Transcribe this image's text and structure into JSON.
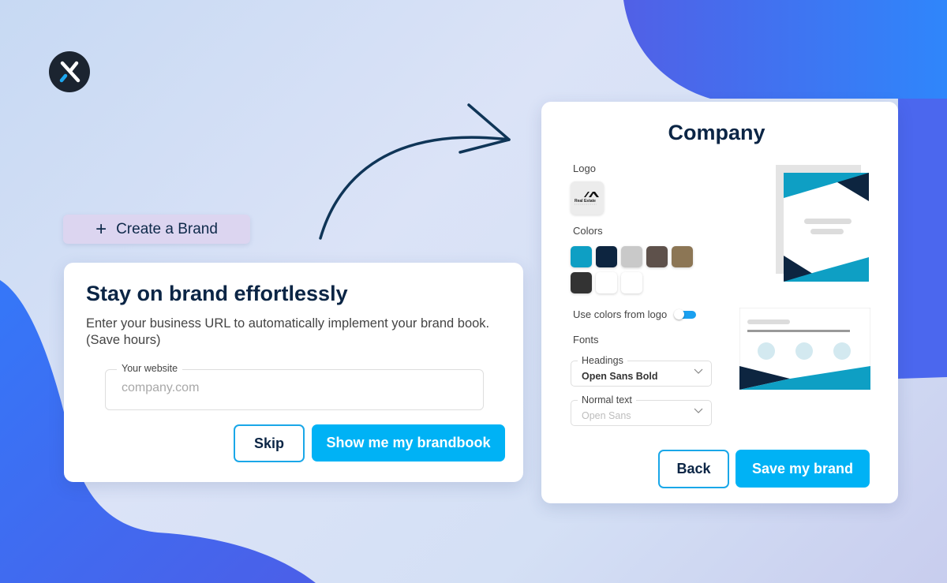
{
  "app": {
    "logo_icon": "close-x-logo-icon"
  },
  "create_brand": {
    "icon": "plus-icon",
    "plus_glyph": "+",
    "label": "Create a Brand"
  },
  "intro_card": {
    "title": "Stay on brand effortlessly",
    "description": "Enter your business URL to automatically implement your brand book. (Save hours)",
    "website_field": {
      "label": "Your website",
      "placeholder": "company.com",
      "value": ""
    },
    "skip_label": "Skip",
    "show_label": "Show me my brandbook"
  },
  "brand_card": {
    "title": "Company",
    "logo_label": "Logo",
    "logo_text": "Real Estate",
    "colors_label": "Colors",
    "colors": [
      "#0e9fc4",
      "#0d2540",
      "#c9c9c9",
      "#5e514b",
      "#8c7655",
      "#333333",
      "#ffffff",
      "#ffffff"
    ],
    "use_logo_colors_label": "Use colors from logo",
    "use_logo_colors": true,
    "fonts_label": "Fonts",
    "headings": {
      "label": "Headings",
      "value": "Open Sans Bold"
    },
    "normal_text": {
      "label": "Normal text",
      "value": "Open Sans"
    },
    "back_label": "Back",
    "save_label": "Save my brand"
  },
  "theme": {
    "accent": "#00b2f5",
    "navy": "#0b2545",
    "teal": "#0e9fc4",
    "blob": "#4a68ee"
  }
}
